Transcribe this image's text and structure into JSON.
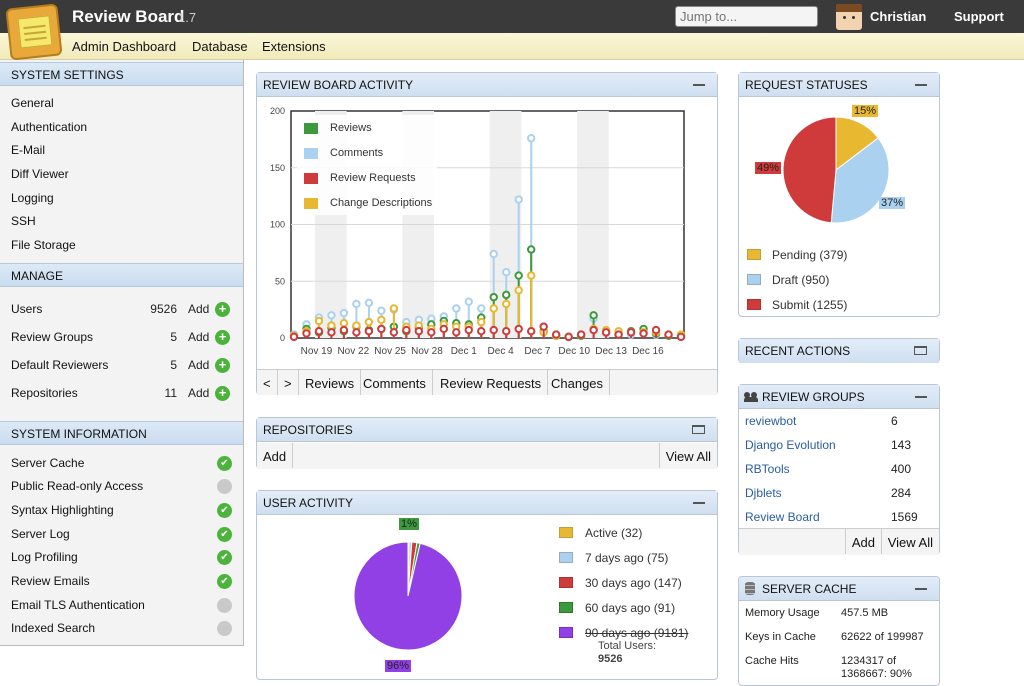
{
  "header": {
    "title": "Review Board",
    "version": "1.7",
    "jump_placeholder": "Jump to...",
    "user": "Christian",
    "support": "Support"
  },
  "nav": {
    "items": [
      "Admin Dashboard",
      "Database",
      "Extensions"
    ]
  },
  "sidebar": {
    "system_settings": {
      "title": "SYSTEM SETTINGS",
      "items": [
        "General",
        "Authentication",
        "E-Mail",
        "Diff Viewer",
        "Logging",
        "SSH",
        "File Storage"
      ]
    },
    "manage": {
      "title": "MANAGE",
      "add_label": "Add",
      "items": [
        {
          "label": "Users",
          "count": "9526"
        },
        {
          "label": "Review Groups",
          "count": "5"
        },
        {
          "label": "Default Reviewers",
          "count": "5"
        },
        {
          "label": "Repositories",
          "count": "11"
        }
      ]
    },
    "system_information": {
      "title": "SYSTEM INFORMATION",
      "items": [
        {
          "label": "Server Cache",
          "ok": true
        },
        {
          "label": "Public Read-only Access",
          "ok": false
        },
        {
          "label": "Syntax Highlighting",
          "ok": true
        },
        {
          "label": "Server Log",
          "ok": true
        },
        {
          "label": "Log Profiling",
          "ok": true
        },
        {
          "label": "Review Emails",
          "ok": true
        },
        {
          "label": "Email TLS Authentication",
          "ok": false
        },
        {
          "label": "Indexed Search",
          "ok": false
        }
      ]
    }
  },
  "activity": {
    "title": "REVIEW BOARD ACTIVITY",
    "buttons": [
      "<",
      ">",
      "Reviews",
      "Comments",
      "Review Requests",
      "Changes"
    ],
    "chart_data": {
      "type": "line",
      "ylim": [
        0,
        200
      ],
      "yticks": [
        "200",
        "150",
        "100",
        "50",
        "0"
      ],
      "xtick_labels": [
        "Nov 19",
        "Nov 22",
        "Nov 25",
        "Nov 28",
        "Dec 1",
        "Dec 4",
        "Dec 7",
        "Dec 10",
        "Dec 13",
        "Dec 16"
      ],
      "series": [
        {
          "name": "Reviews",
          "color": "#3c9a3c",
          "values": [
            2,
            8,
            5,
            9,
            6,
            10,
            7,
            8,
            10,
            6,
            9,
            12,
            15,
            13,
            12,
            18,
            36,
            38,
            55,
            78,
            6,
            2,
            1,
            2,
            20,
            6,
            3,
            6,
            8,
            4,
            2,
            2
          ]
        },
        {
          "name": "Comments",
          "color": "#aad1f0",
          "values": [
            3,
            12,
            18,
            20,
            22,
            30,
            31,
            24,
            25,
            14,
            16,
            17,
            19,
            26,
            32,
            26,
            74,
            58,
            122,
            176,
            10,
            3,
            1,
            2,
            17,
            4,
            4,
            3,
            4,
            3,
            3,
            2
          ]
        },
        {
          "name": "Review Requests",
          "color": "#cf3b3b",
          "values": [
            1,
            4,
            6,
            5,
            7,
            5,
            6,
            8,
            5,
            7,
            6,
            5,
            8,
            5,
            7,
            6,
            7,
            6,
            8,
            6,
            10,
            3,
            1,
            3,
            7,
            5,
            3,
            5,
            4,
            7,
            3,
            1
          ]
        },
        {
          "name": "Change Descriptions",
          "color": "#e8b831",
          "values": [
            2,
            6,
            15,
            11,
            13,
            11,
            14,
            16,
            26,
            10,
            11,
            8,
            12,
            10,
            10,
            14,
            26,
            30,
            42,
            55,
            5,
            2,
            1,
            3,
            8,
            7,
            6,
            5,
            5,
            5,
            3,
            3
          ]
        }
      ]
    }
  },
  "repositories": {
    "title": "REPOSITORIES",
    "add": "Add",
    "view_all": "View All"
  },
  "user_activity": {
    "title": "USER ACTIVITY",
    "pie_labels": {
      "big": "96%",
      "small": "1%"
    },
    "chart_data": {
      "type": "pie",
      "slices": [
        {
          "label": "Active (32)",
          "value": 32,
          "color": "#e8b831"
        },
        {
          "label": "7 days ago (75)",
          "value": 75,
          "color": "#aad1f0"
        },
        {
          "label": "30 days ago (147)",
          "value": 147,
          "color": "#cf3b3b"
        },
        {
          "label": "60 days ago (91)",
          "value": 91,
          "color": "#3c9a3c"
        },
        {
          "label": "90 days ago (9181)",
          "value": 9181,
          "color": "#9140e5"
        }
      ]
    },
    "total_label": "Total Users:",
    "total": "9526"
  },
  "request_statuses": {
    "title": "REQUEST STATUSES",
    "chart_data": {
      "type": "pie",
      "slices": [
        {
          "label": "Pending (379)",
          "value": 379,
          "pct": "15%",
          "color": "#e8b831"
        },
        {
          "label": "Draft (950)",
          "value": 950,
          "pct": "37%",
          "color": "#aad1f0"
        },
        {
          "label": "Submit (1255)",
          "value": 1255,
          "pct": "49%",
          "color": "#cf3b3b"
        }
      ]
    }
  },
  "recent_actions": {
    "title": "RECENT ACTIONS"
  },
  "review_groups": {
    "title": "REVIEW GROUPS",
    "add": "Add",
    "view_all": "View All",
    "rows": [
      {
        "name": "reviewbot",
        "count": "6"
      },
      {
        "name": "Django Evolution",
        "count": "143"
      },
      {
        "name": "RBTools",
        "count": "400"
      },
      {
        "name": "Djblets",
        "count": "284"
      },
      {
        "name": "Review Board",
        "count": "1569"
      }
    ]
  },
  "server_cache": {
    "title": "SERVER CACHE",
    "rows": [
      {
        "label": "Memory Usage",
        "value": "457.5 MB"
      },
      {
        "label": "Keys in Cache",
        "value": "62622 of 199987"
      },
      {
        "label": "Cache Hits",
        "value": "1234317 of 1368667: 90%"
      }
    ]
  }
}
